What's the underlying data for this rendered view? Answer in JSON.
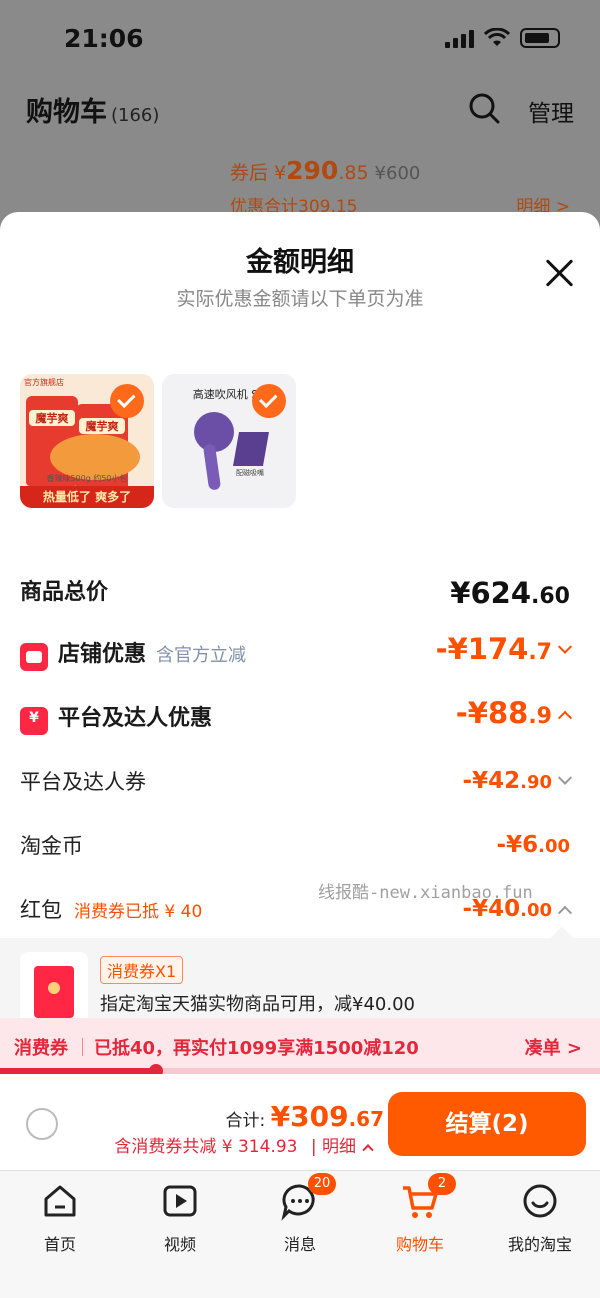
{
  "status": {
    "time": "21:06"
  },
  "header": {
    "title": "购物车",
    "count": "(166)",
    "manage": "管理"
  },
  "bg_item": {
    "price_prefix": "券后 ¥",
    "price_int": "290",
    "price_dec": ".85",
    "orig_price": "¥600",
    "discount_total": "优惠合计309.15",
    "detail_link": "明细 >"
  },
  "sheet": {
    "title": "金额明细",
    "subtitle": "实际优惠金额请以下单页为准",
    "products": [
      {
        "shop_tag": "官方旗舰店",
        "label": "魔芋爽",
        "caption": "香辣味500g 约50小包",
        "banner": "热量低了 爽多了"
      },
      {
        "title": "高速吹风机 SE",
        "caption": "配磁吸嘴"
      }
    ],
    "total_label": "商品总价",
    "total_int": "¥624",
    "total_dec": ".60",
    "shop_discount": {
      "label": "店铺优惠",
      "tag": "含官方立减",
      "value_int": "-¥174",
      "value_dec": ".7"
    },
    "platform_discount": {
      "label": "平台及达人优惠",
      "value_int": "-¥88",
      "value_dec": ".9"
    },
    "platform_coupon": {
      "label": "平台及达人券",
      "value_int": "-¥42",
      "value_dec": ".90"
    },
    "taojinbi": {
      "label": "淘金币",
      "value_int": "-¥6",
      "value_dec": ".00"
    },
    "hongbao": {
      "label": "红包",
      "tag": "消费券已抵 ¥ 40",
      "value_int": "-¥40",
      "value_dec": ".00"
    },
    "watermark": "线报酷-new.xianbao.fun",
    "coupon": {
      "badge": "消费券X1",
      "desc": "指定淘宝天猫实物商品可用，减¥40.00"
    }
  },
  "xfq_bar": {
    "label": "消费券",
    "text": "已抵40，再实付1099享满1500减120",
    "link": "凑单 >",
    "progress": 0.26
  },
  "checkout": {
    "sum_label": "合计:",
    "sum_int": "¥309",
    "sum_dec": ".67",
    "sub": "含消费券共减 ¥ 314.93",
    "detail": "明细",
    "pay": "结算(2)"
  },
  "tabs": [
    {
      "label": "首页",
      "icon": "home-icon"
    },
    {
      "label": "视频",
      "icon": "video-icon"
    },
    {
      "label": "消息",
      "icon": "message-icon",
      "badge": "20"
    },
    {
      "label": "购物车",
      "icon": "cart-icon",
      "badge": "2",
      "active": true
    },
    {
      "label": "我的淘宝",
      "icon": "profile-icon"
    }
  ],
  "colors": {
    "accent": "#ff5000",
    "red": "#e4273b",
    "pay_button": "#ff5a00"
  }
}
